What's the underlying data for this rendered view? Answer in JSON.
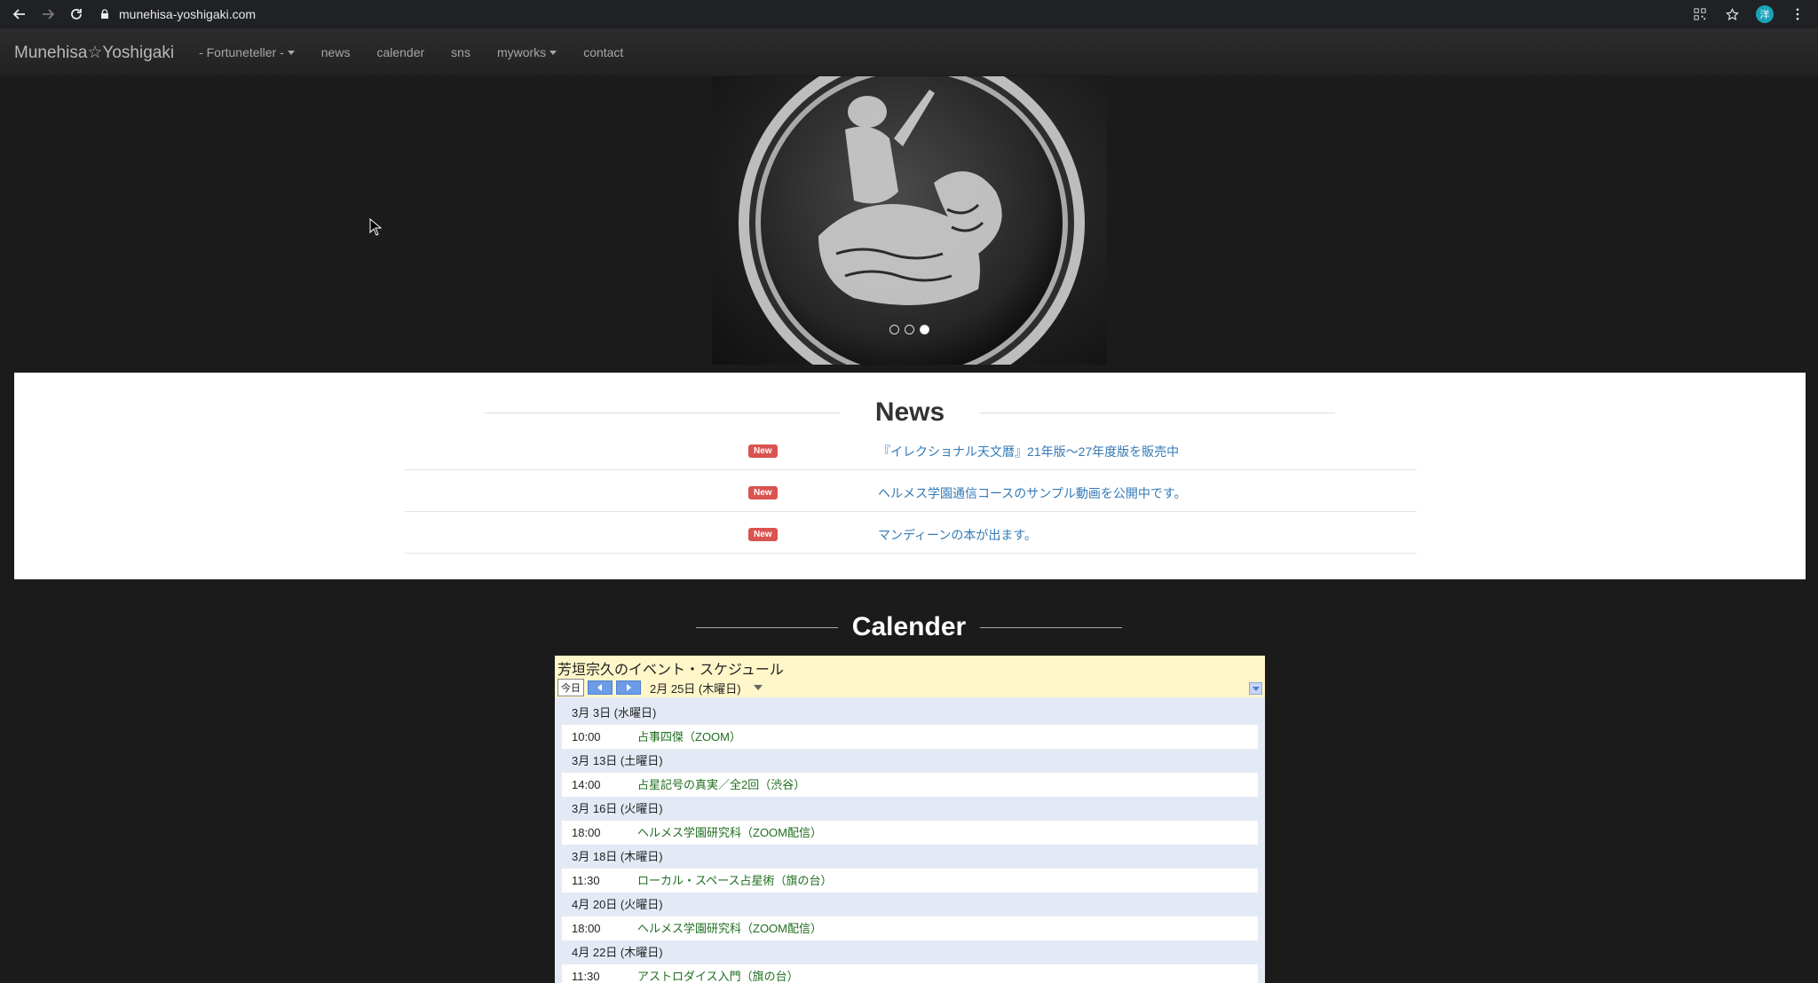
{
  "browser": {
    "url": "munehisa-yoshigaki.com",
    "avatar_letter": "洋"
  },
  "navbar": {
    "brand": "Munehisa☆Yoshigaki",
    "items": [
      {
        "label": "- Fortuneteller -",
        "dropdown": true
      },
      {
        "label": "news",
        "dropdown": false
      },
      {
        "label": "calender",
        "dropdown": false
      },
      {
        "label": "sns",
        "dropdown": false
      },
      {
        "label": "myworks",
        "dropdown": true
      },
      {
        "label": "contact",
        "dropdown": false
      }
    ]
  },
  "carousel": {
    "slide_count": 3,
    "active_index": 2
  },
  "news": {
    "title": "News",
    "items": [
      {
        "badge": "New",
        "text": "『イレクショナル天文暦』21年版〜27年度版を販売中"
      },
      {
        "badge": "New",
        "text": "ヘルメス学園通信コースのサンプル動画を公開中です。"
      },
      {
        "badge": "New",
        "text": "マンディーンの本が出ます。"
      }
    ]
  },
  "calendar": {
    "section_title": "Calender",
    "name": "芳垣宗久のイベント・スケジュール",
    "today_label": "今日",
    "current_date": "2月 25日 (木曜日)",
    "days": [
      {
        "date": "3月 3日 (水曜日)",
        "events": [
          {
            "time": "10:00",
            "title": "占事四傑（ZOOM）"
          }
        ]
      },
      {
        "date": "3月 13日 (土曜日)",
        "events": [
          {
            "time": "14:00",
            "title": "占星記号の真実／全2回（渋谷）"
          }
        ]
      },
      {
        "date": "3月 16日 (火曜日)",
        "events": [
          {
            "time": "18:00",
            "title": "ヘルメス学園研究科（ZOOM配信）"
          }
        ]
      },
      {
        "date": "3月 18日 (木曜日)",
        "events": [
          {
            "time": "11:30",
            "title": "ローカル・スペース占星術（旗の台）"
          }
        ]
      },
      {
        "date": "4月 20日 (火曜日)",
        "events": [
          {
            "time": "18:00",
            "title": "ヘルメス学園研究科（ZOOM配信）"
          }
        ]
      },
      {
        "date": "4月 22日 (木曜日)",
        "events": [
          {
            "time": "11:30",
            "title": "アストロダイス入門（旗の台）"
          }
        ]
      }
    ]
  },
  "colors": {
    "page_bg": "#1b1b1b",
    "badge": "#d9534f",
    "link": "#337ab7",
    "event_title": "#1f6e1f",
    "calendar_header": "#fff7c9"
  }
}
